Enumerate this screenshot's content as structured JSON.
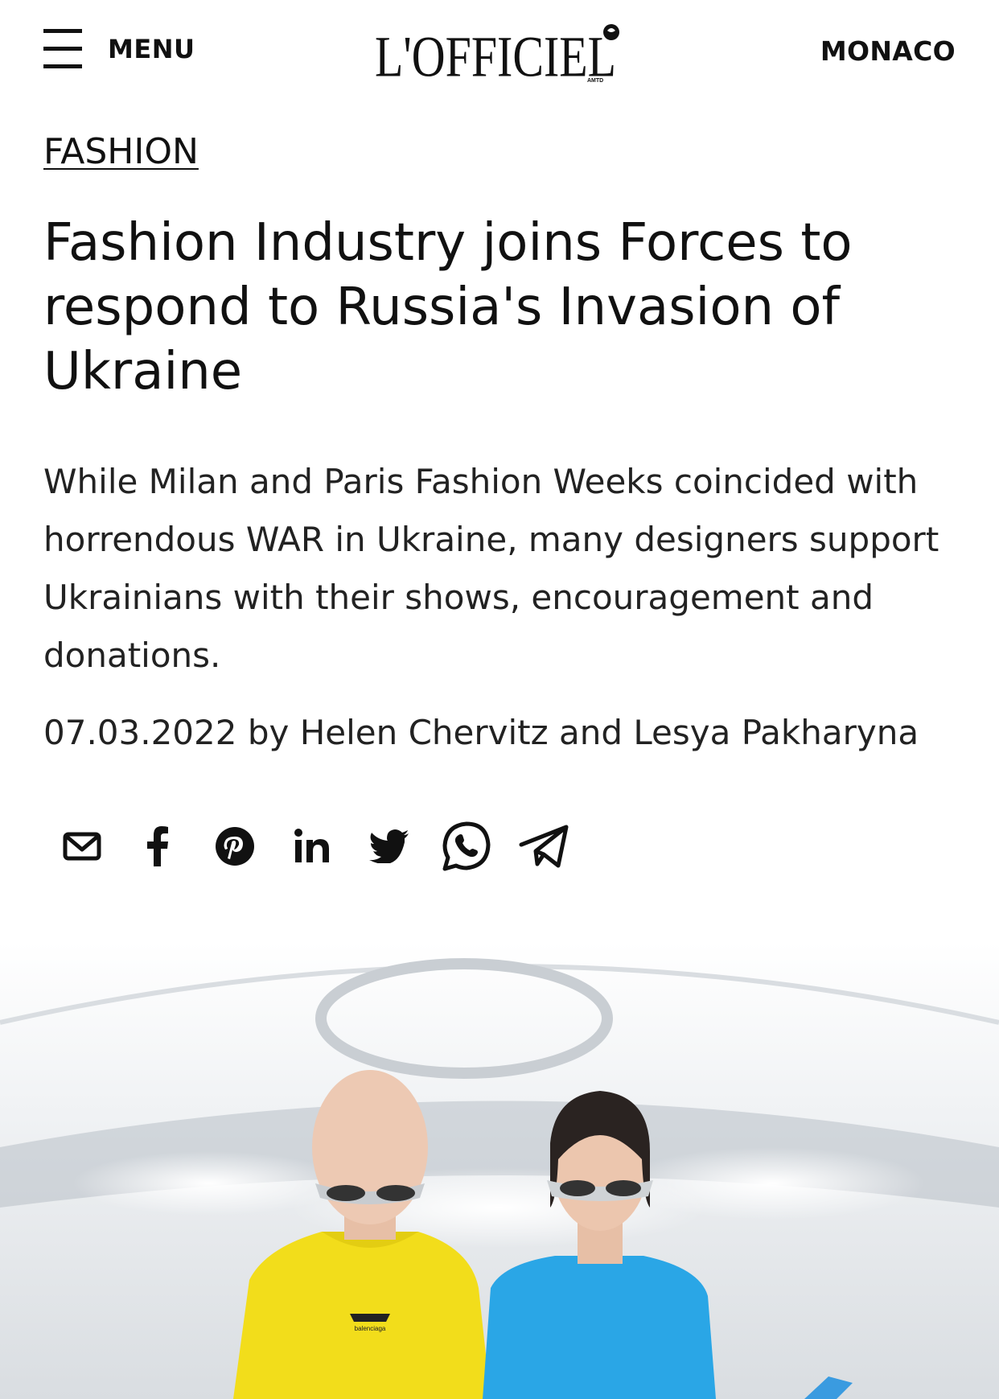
{
  "header": {
    "menu_label": "MENU",
    "logo_text": "L'OFFICIEL",
    "logo_sub": "AMTD",
    "region_label": "MONACO"
  },
  "article": {
    "category": "FASHION",
    "title": "Fashion Industry joins Forces to respond to Russia's Invasion of Ukraine",
    "standfirst": "While Milan and Paris Fashion Weeks coincided with horrendous WAR in Ukraine, many designers support Ukrainians with their shows, encouragement and donations.",
    "byline": "07.03.2022 by Helen Chervitz and Lesya Pakharyna"
  },
  "share": {
    "icons": [
      "email-icon",
      "facebook-icon",
      "pinterest-icon",
      "linkedin-icon",
      "twitter-icon",
      "whatsapp-icon",
      "telegram-icon"
    ]
  },
  "hero": {
    "hoodie_logo": "balenciaga",
    "colors": {
      "hoodie": "#f2dd1b",
      "top": "#2aa6e6",
      "sky": "#e9ecef"
    }
  }
}
